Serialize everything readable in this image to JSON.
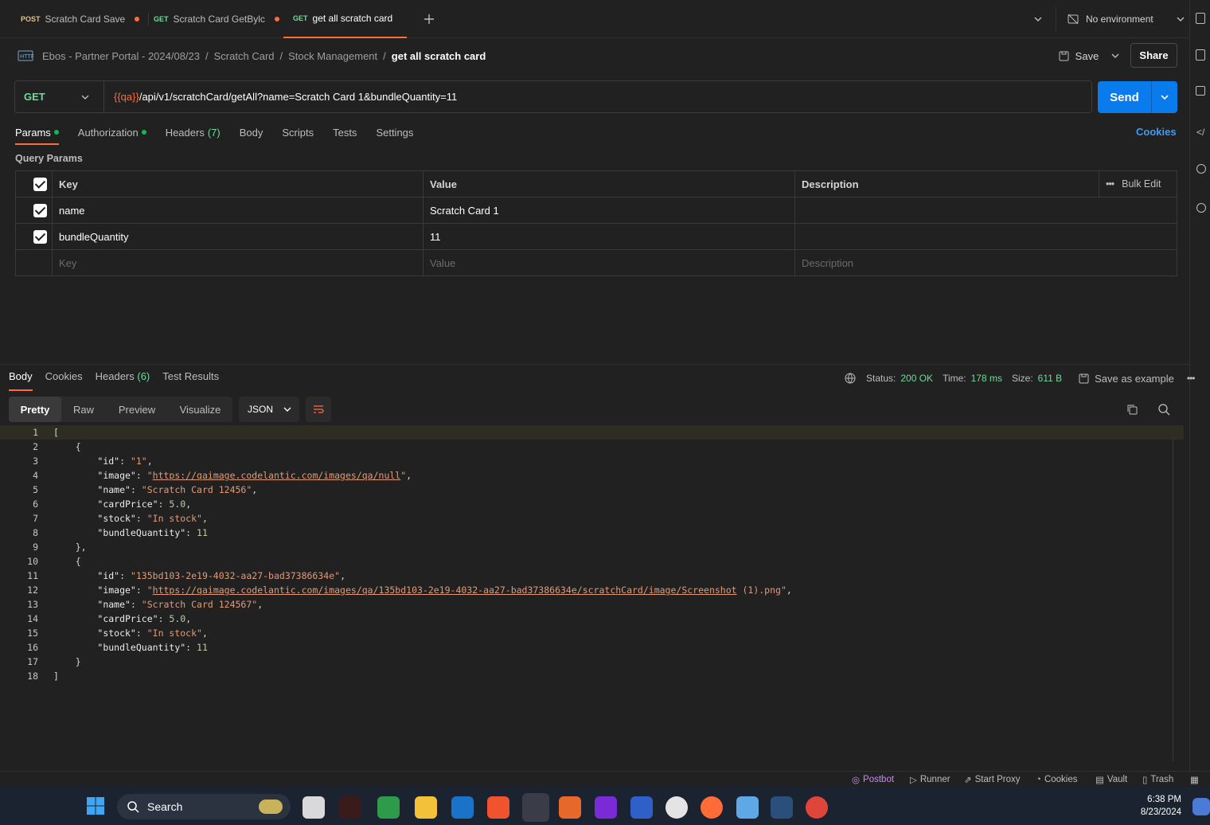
{
  "tabs": [
    {
      "method": "POST",
      "label": "Scratch Card Save",
      "method_color": "#e5c07b"
    },
    {
      "method": "GET",
      "label": "Scratch Card GetBylc",
      "method_color": "#6bdd9a"
    },
    {
      "method": "GET",
      "label": "get all scratch card",
      "method_color": "#6bdd9a"
    }
  ],
  "environment": "No environment",
  "breadcrumb": {
    "items": [
      "Ebos - Partner Portal - 2024/08/23",
      "/",
      "Scratch Card",
      "/",
      "Stock Management",
      "/"
    ],
    "current": "get all scratch card"
  },
  "toolbar": {
    "save_label": "Save",
    "share_label": "Share"
  },
  "request": {
    "method": "GET",
    "url_var": "{{qa}}",
    "url_rest": "/api/v1/scratchCard/getAll?name=Scratch Card 1&bundleQuantity=11",
    "send_label": "Send"
  },
  "request_tabs": {
    "params": "Params",
    "authorization": "Authorization",
    "headers": "Headers",
    "headers_count": "(7)",
    "body": "Body",
    "scripts": "Scripts",
    "tests": "Tests",
    "settings": "Settings",
    "cookies": "Cookies"
  },
  "query_params": {
    "title": "Query Params",
    "columns": {
      "key": "Key",
      "value": "Value",
      "description": "Description",
      "bulk_edit": "Bulk Edit"
    },
    "rows": [
      {
        "key": "name",
        "value": "Scratch Card 1",
        "description": ""
      },
      {
        "key": "bundleQuantity",
        "value": "11",
        "description": ""
      }
    ],
    "placeholder": {
      "key": "Key",
      "value": "Value",
      "description": "Description"
    }
  },
  "response": {
    "tabs": {
      "body": "Body",
      "cookies": "Cookies",
      "headers": "Headers",
      "headers_count": "(6)",
      "test_results": "Test Results"
    },
    "status_label": "Status:",
    "status": "200 OK",
    "time_label": "Time:",
    "time": "178 ms",
    "size_label": "Size:",
    "size": "611 B",
    "save_example": "Save as example",
    "views": [
      "Pretty",
      "Raw",
      "Preview",
      "Visualize"
    ],
    "format": "JSON",
    "lines": [
      "[",
      "    {",
      "        \"id\": \"1\",",
      "        \"image\": \"https://qaimage.codelantic.com/images/qa/null\",",
      "        \"name\": \"Scratch Card 12456\",",
      "        \"cardPrice\": 5.0,",
      "        \"stock\": \"In stock\",",
      "        \"bundleQuantity\": 11",
      "    },",
      "    {",
      "        \"id\": \"135bd103-2e19-4032-aa27-bad37386634e\",",
      "        \"image\": \"https://qaimage.codelantic.com/images/qa/135bd103-2e19-4032-aa27-bad37386634e/scratchCard/image/Screenshot (1).png\",",
      "        \"name\": \"Scratch Card 124567\",",
      "        \"cardPrice\": 5.0,",
      "        \"stock\": \"In stock\",",
      "        \"bundleQuantity\": 11",
      "    }",
      "]"
    ]
  },
  "footer": {
    "postbot": "Postbot",
    "runner": "Runner",
    "start_proxy": "Start Proxy",
    "cookies": "Cookies",
    "vault": "Vault",
    "trash": "Trash"
  },
  "taskbar": {
    "search": "Search",
    "time": "6:38 PM",
    "date": "8/23/2024"
  },
  "colors": {
    "accent": "#ff6c37",
    "send": "#097bed",
    "get": "#6bdd9a",
    "ok": "#0cbb52"
  }
}
